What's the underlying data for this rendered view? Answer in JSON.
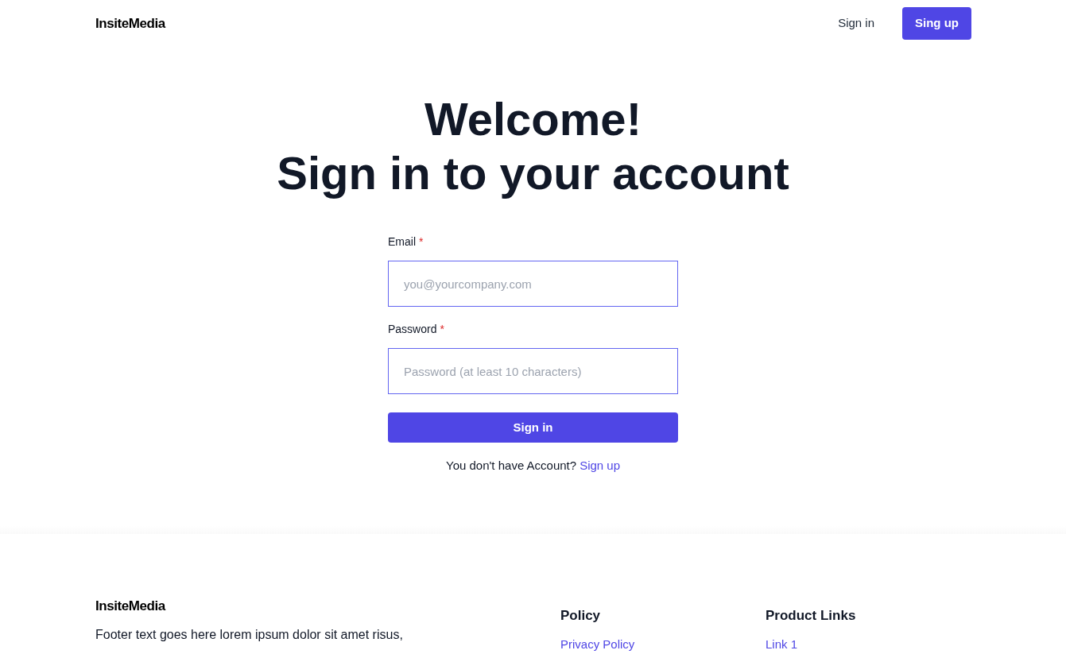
{
  "header": {
    "logo": "InsiteMedia",
    "nav": [
      {
        "label": "Sign in",
        "kind": "link"
      },
      {
        "label": "Sing up",
        "kind": "primary"
      }
    ]
  },
  "hero": {
    "title_lines": [
      "Welcome!",
      "Sign in to your account"
    ]
  },
  "form": {
    "fields": [
      {
        "label": "Email",
        "required": true,
        "required_mark": "*",
        "placeholder": "you@yourcompany.com"
      },
      {
        "label": "Password",
        "required": true,
        "required_mark": "*",
        "placeholder": "Password (at least 10 characters)"
      }
    ],
    "submit": "Sign in",
    "prompt": "You don't have Account?",
    "prompt_link": "Sign up"
  },
  "footer": {
    "logo": "InsiteMedia",
    "text": "Footer text goes here lorem ipsum dolor sit amet risus,",
    "columns": [
      {
        "heading": "Policy",
        "links": [
          "Privacy Policy"
        ]
      },
      {
        "heading": "Product Links",
        "links": [
          "Link 1"
        ]
      }
    ]
  }
}
